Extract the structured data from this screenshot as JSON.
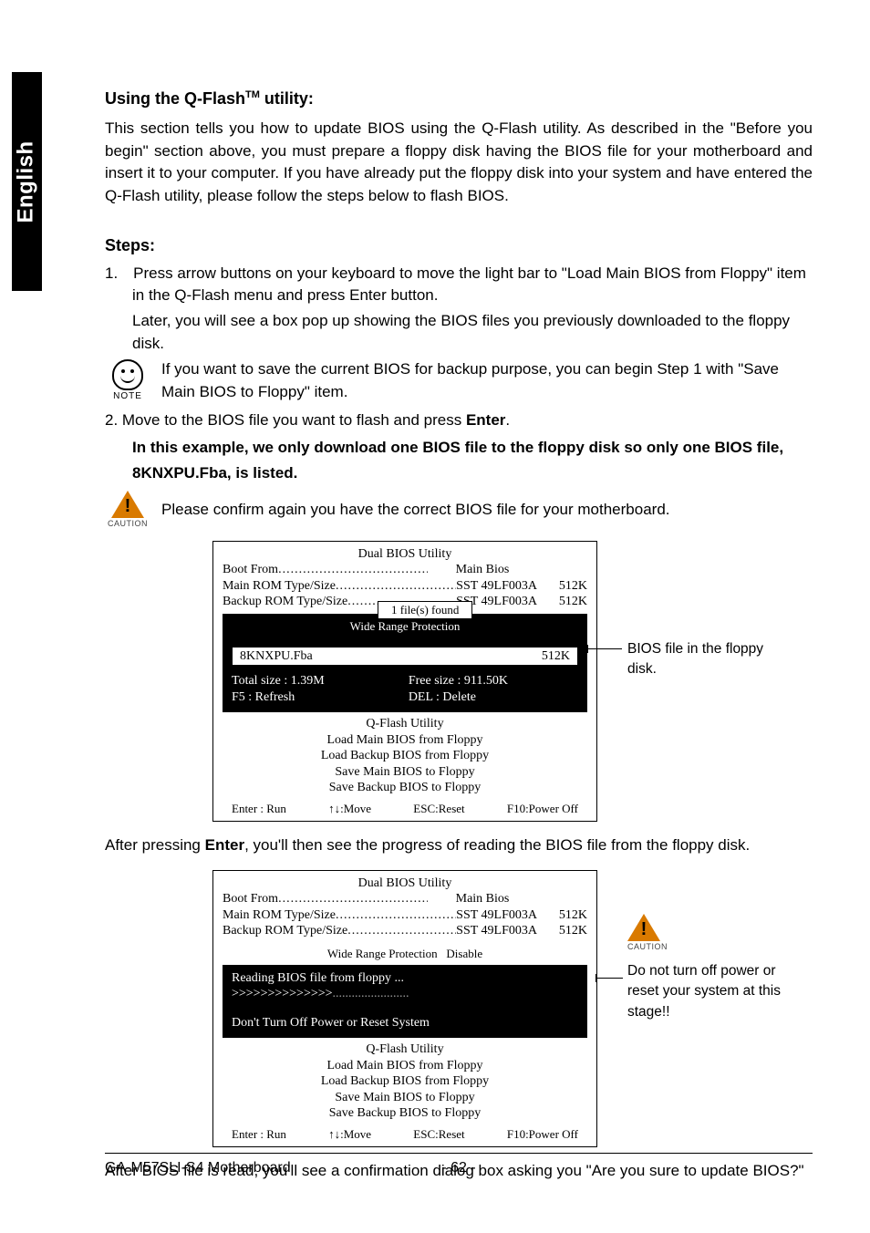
{
  "side_tab": "English",
  "heading_pre": "Using the Q-Flash",
  "heading_tm": "TM",
  "heading_post": " utility:",
  "intro": "This section tells you how to update BIOS using the Q-Flash utility. As described in the \"Before you begin\" section above, you must prepare a floppy disk having the BIOS file for your motherboard and insert it to your computer. If you have already put the floppy disk into your system and have entered the Q-Flash utility, please follow the steps below to flash BIOS.",
  "steps_heading": "Steps:",
  "step1_line1": "1. Press arrow buttons on your keyboard to move the light bar to \"Load Main BIOS from Floppy\" item in the Q-Flash menu and press Enter button.",
  "step1_line2": "Later, you will see a box pop up showing the BIOS files you previously downloaded to the floppy disk.",
  "note_label": "NOTE",
  "note_text": "If you want to save the current BIOS for backup purpose, you can begin Step 1 with \"Save Main BIOS to Floppy\" item.",
  "step2_a": "2. Move to the BIOS file you want to flash and press ",
  "step2_b_bold": "Enter",
  "step2_c": ".",
  "example_line1": "In this example, we only download one BIOS file to the floppy disk so only one BIOS file,",
  "example_line2": "8KNXPU.Fba, is listed.",
  "caution_label": "CAUTION",
  "caution_text": "Please confirm again you have the correct BIOS file for your motherboard.",
  "bios": {
    "title": "Dual BIOS Utility",
    "boot_label": "Boot From",
    "boot_value": "Main Bios",
    "main_rom_label": "Main ROM Type/Size",
    "main_rom_value": "SST 49LF003A",
    "main_rom_size": "512K",
    "backup_rom_label": "Backup ROM Type/Size",
    "backup_rom_value": "SST 49LF003A",
    "backup_rom_size": "512K",
    "wrp": "Wide Range Protection",
    "wrp_val": "Disable",
    "popup": "1 file(s) found",
    "file_name": "8KNXPU.Fba",
    "file_size": "512K",
    "total": "Total size : 1.39M",
    "free": "Free size : 911.50K",
    "f5": "F5 : Refresh",
    "del": "DEL : Delete",
    "util": "Q-Flash Utility",
    "menu1": "Load Main BIOS from Floppy",
    "menu2": "Load Backup BIOS from Floppy",
    "menu3": "Save Main BIOS to Floppy",
    "menu4": "Save Backup BIOS to Floppy",
    "foot_run": "Enter : Run",
    "foot_move": "↑↓:Move",
    "foot_reset": "ESC:Reset",
    "foot_power": "F10:Power Off"
  },
  "callout1": "BIOS file in the floppy disk.",
  "after1_a": "After pressing ",
  "after1_b_bold": "Enter",
  "after1_c": ", you'll then see the progress of reading the BIOS file from the floppy disk.",
  "bios2": {
    "reading": "Reading BIOS file from floppy ...",
    "prog": ">>>>>>>>>>>>>>",
    "prog_dots": "........................",
    "warn": "Don't Turn Off Power or Reset System"
  },
  "callout2": "Do not turn off power or reset your system at this stage!!",
  "after2": "After BIOS file is read, you'll see a confirmation dialog box asking you \"Are you sure to update BIOS?\"",
  "footer_left": "GA-M57SLI-S4 Motherboard",
  "footer_mid": "- 62 -"
}
